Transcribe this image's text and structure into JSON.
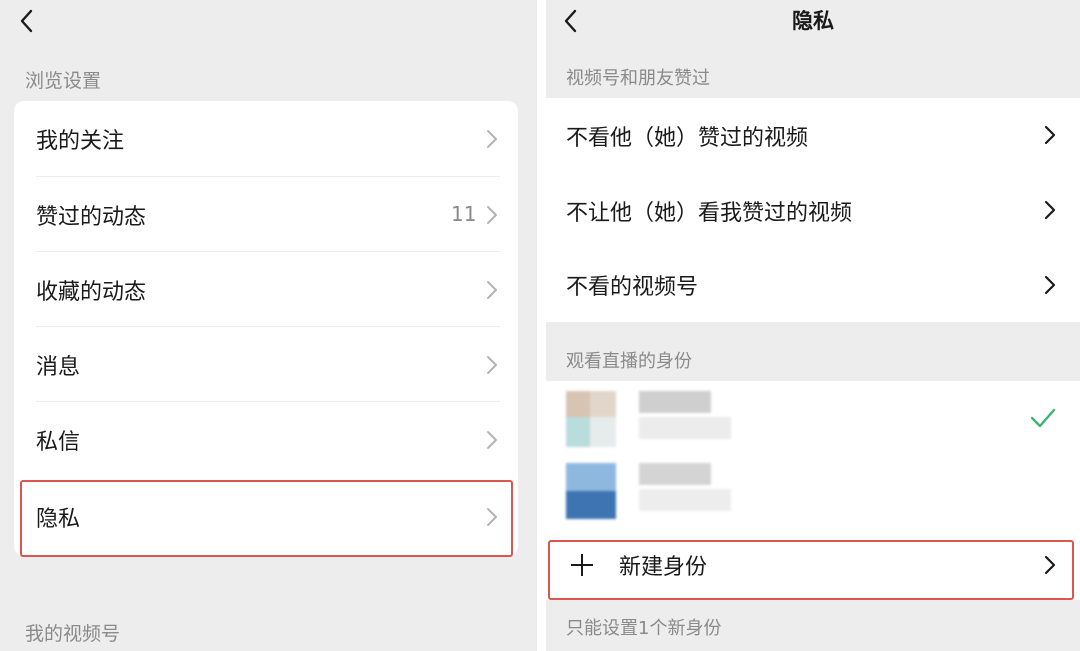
{
  "left": {
    "section_browse": "浏览设置",
    "items": [
      {
        "label": "我的关注",
        "count": ""
      },
      {
        "label": "赞过的动态",
        "count": "11"
      },
      {
        "label": "收藏的动态",
        "count": ""
      },
      {
        "label": "消息",
        "count": ""
      },
      {
        "label": "私信",
        "count": ""
      },
      {
        "label": "隐私",
        "count": ""
      }
    ],
    "section_channels": "我的视频号"
  },
  "right": {
    "title": "隐私",
    "section_liked": "视频号和朋友赞过",
    "items": [
      {
        "label": "不看他（她）赞过的视频"
      },
      {
        "label": "不让他（她）看我赞过的视频"
      },
      {
        "label": "不看的视频号"
      }
    ],
    "section_live": "观看直播的身份",
    "identities": [
      {
        "selected": true
      },
      {
        "selected": false
      }
    ],
    "new_identity_label": "新建身份",
    "footer_note": "只能设置1个新身份"
  },
  "colors": {
    "background": "#ededed",
    "card": "#ffffff",
    "highlight": "#d9574f",
    "check": "#3cb371",
    "secondary_text": "#8a8a8a"
  },
  "icons": {
    "back": "chevron-left-icon",
    "row": "chevron-right-icon",
    "selected": "checkmark-icon",
    "add": "plus-icon"
  }
}
